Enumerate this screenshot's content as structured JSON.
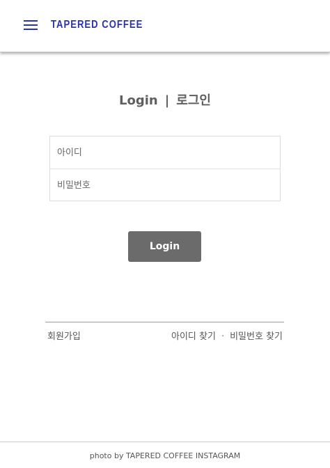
{
  "header": {
    "brand": "TAPERED COFFEE",
    "menu_icon": "hamburger-menu-icon",
    "accent_color": "#2a34a8"
  },
  "login": {
    "title_en": "Login",
    "title_separator": "|",
    "title_ko": "로그인",
    "id_placeholder": "아이디",
    "password_placeholder": "비밀번호",
    "button_label": "Login",
    "button_color": "#6b6b6b"
  },
  "links": {
    "join": "회원가입",
    "find_id": "아이디 찾기",
    "separator": "·",
    "find_password": "비밀번호 찾기"
  },
  "footer": {
    "credit": "photo by TAPERED COFFEE INSTAGRAM"
  }
}
